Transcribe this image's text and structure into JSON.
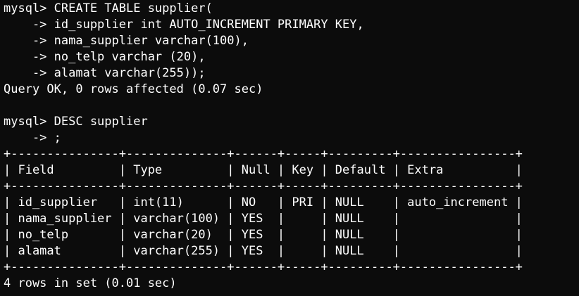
{
  "terminal": {
    "lines": [
      "mysql> CREATE TABLE supplier(",
      "    -> id_supplier int AUTO_INCREMENT PRIMARY KEY,",
      "    -> nama_supplier varchar(100),",
      "    -> no_telp varchar (20),",
      "    -> alamat varchar(255));",
      "Query OK, 0 rows affected (0.07 sec)",
      "",
      "mysql> DESC supplier",
      "    -> ;",
      "+---------------+--------------+------+-----+---------+----------------+",
      "| Field         | Type         | Null | Key | Default | Extra          |",
      "+---------------+--------------+------+-----+---------+----------------+",
      "| id_supplier   | int(11)      | NO   | PRI | NULL    | auto_increment |",
      "| nama_supplier | varchar(100) | YES  |     | NULL    |                |",
      "| no_telp       | varchar(20)  | YES  |     | NULL    |                |",
      "| alamat        | varchar(255) | YES  |     | NULL    |                |",
      "+---------------+--------------+------+-----+---------+----------------+",
      "4 rows in set (0.01 sec)"
    ],
    "colors": {
      "background": "#0c0c0c",
      "text": "#ffffff"
    }
  }
}
